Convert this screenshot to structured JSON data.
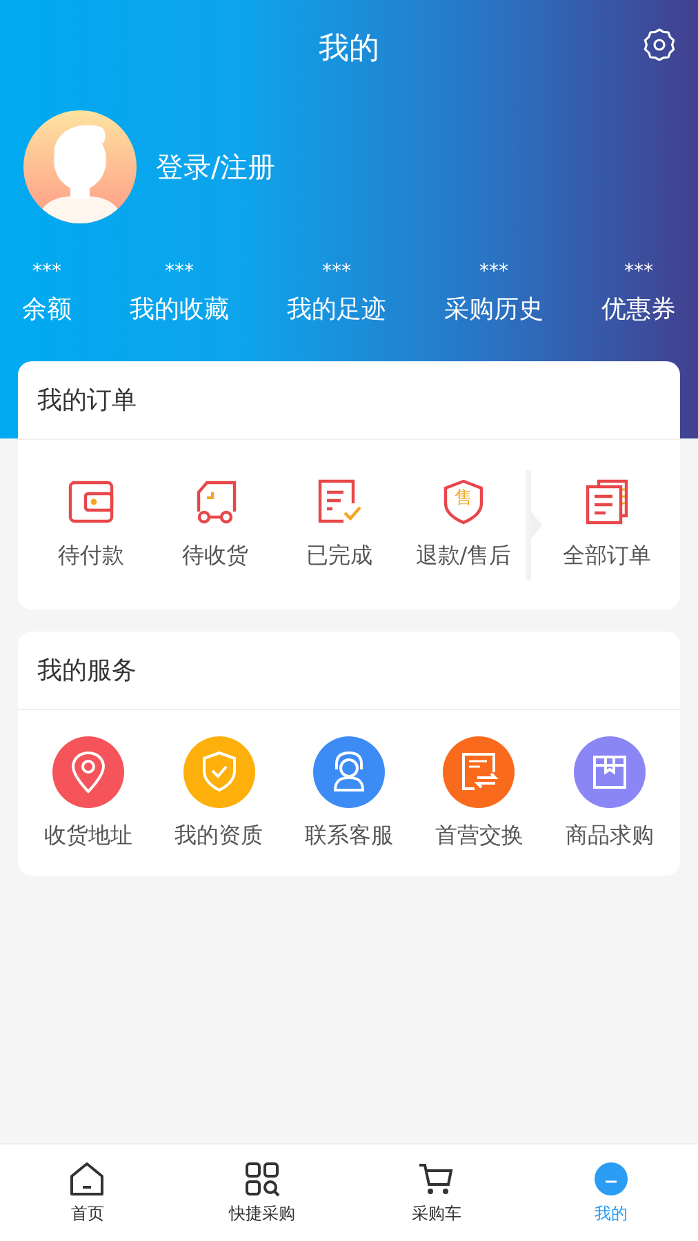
{
  "header": {
    "title": "我的",
    "login_text": "登录/注册"
  },
  "stats": [
    {
      "value": "***",
      "label": "余额"
    },
    {
      "value": "***",
      "label": "我的收藏"
    },
    {
      "value": "***",
      "label": "我的足迹"
    },
    {
      "value": "***",
      "label": "采购历史"
    },
    {
      "value": "***",
      "label": "优惠券"
    }
  ],
  "orders": {
    "title": "我的订单",
    "items": [
      {
        "label": "待付款"
      },
      {
        "label": "待收货"
      },
      {
        "label": "已完成"
      },
      {
        "label": "退款/售后",
        "icon_text": "售"
      }
    ],
    "all_orders": "全部订单"
  },
  "services": {
    "title": "我的服务",
    "items": [
      {
        "label": "收货地址",
        "color": "#f4545a"
      },
      {
        "label": "我的资质",
        "color": "#fdb00c"
      },
      {
        "label": "联系客服",
        "color": "#3d8cf5"
      },
      {
        "label": "首营交换",
        "color": "#fa6a1c"
      },
      {
        "label": "商品求购",
        "color": "#8a86f6"
      }
    ]
  },
  "nav": [
    {
      "label": "首页",
      "selected": false
    },
    {
      "label": "快捷采购",
      "selected": false
    },
    {
      "label": "采购车",
      "selected": false
    },
    {
      "label": "我的",
      "selected": true
    }
  ]
}
